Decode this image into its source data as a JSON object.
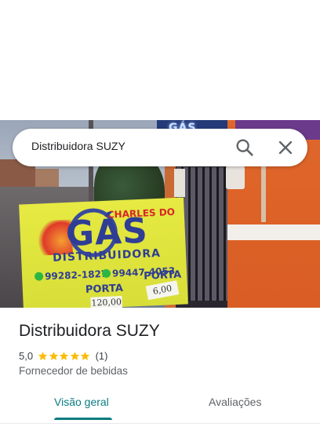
{
  "search": {
    "query": "Distribuidora SUZY",
    "search_icon": "search-icon",
    "close_icon": "close-icon"
  },
  "photo": {
    "storefront_sign": "GÁS",
    "board": {
      "brand_top": "CHARLES DO",
      "brand_main": "GÁS",
      "brand_sub": "DISTRIBUIDORA",
      "phone_1": "99282-1827",
      "phone_2": "99447-4053",
      "porta_left": "PORTA",
      "porta_right": "PORTA",
      "price_left": "120,00",
      "price_right": "6,00"
    }
  },
  "place": {
    "title": "Distribuidora SUZY",
    "rating": "5,0",
    "stars": 5,
    "review_count": "(1)",
    "category": "Fornecedor de bebidas"
  },
  "tabs": [
    {
      "label": "Visão geral",
      "active": true
    },
    {
      "label": "Avaliações",
      "active": false
    }
  ],
  "colors": {
    "accent": "#0b7c80",
    "star": "#fbbc04",
    "text_primary": "#202124",
    "text_secondary": "#5f6368"
  }
}
